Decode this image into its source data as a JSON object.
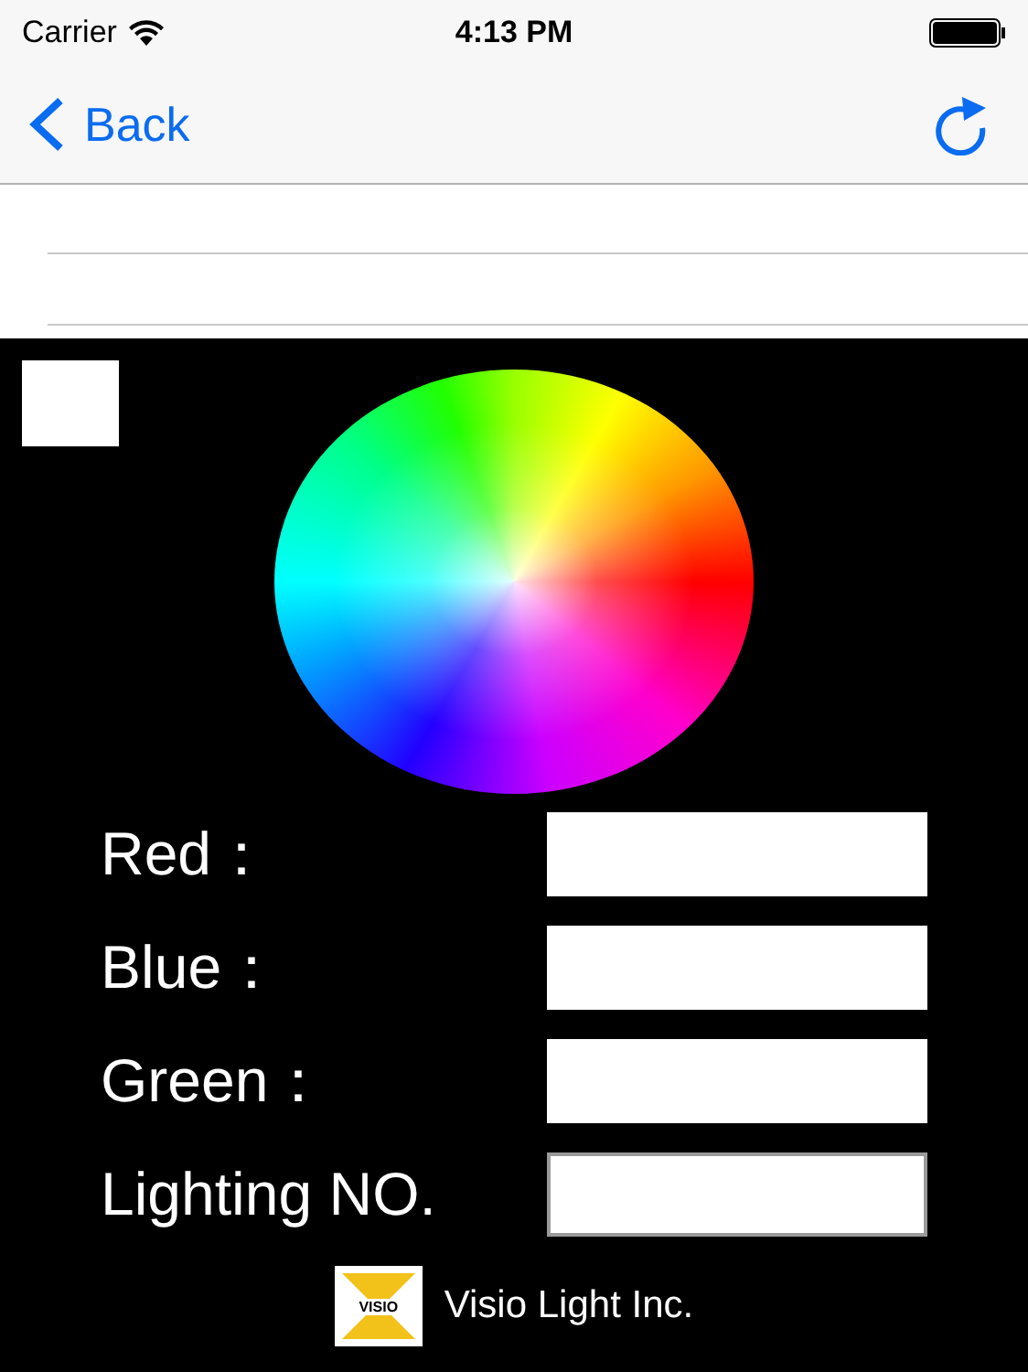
{
  "status_bar": {
    "carrier": "Carrier",
    "time": "4:13 PM"
  },
  "nav_bar": {
    "back_label": "Back"
  },
  "fields": [
    {
      "label": "Red：",
      "kind": "plain"
    },
    {
      "label": "Blue：",
      "kind": "plain"
    },
    {
      "label": "Green：",
      "kind": "plain"
    },
    {
      "label": "Lighting NO.",
      "kind": "inset"
    }
  ],
  "footer": {
    "logo_text": "VISIO",
    "company": "Visio Light Inc."
  }
}
